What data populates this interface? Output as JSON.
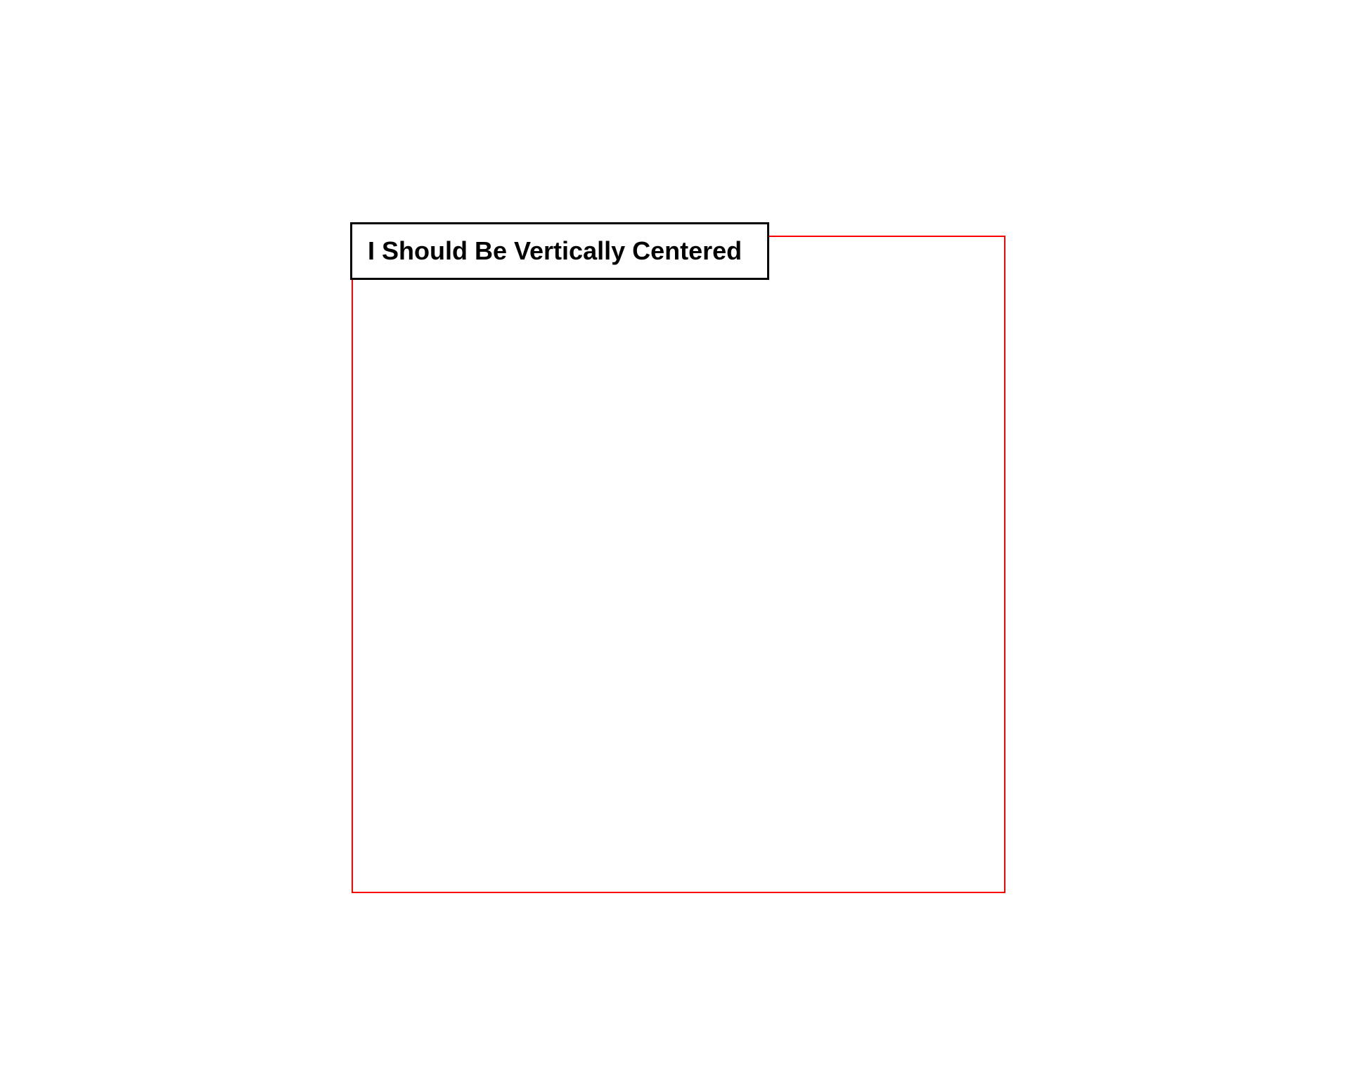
{
  "box": {
    "label": "I Should Be Vertically Centered"
  },
  "colors": {
    "container_border": "#ff0000",
    "box_border": "#000000",
    "text": "#000000"
  }
}
